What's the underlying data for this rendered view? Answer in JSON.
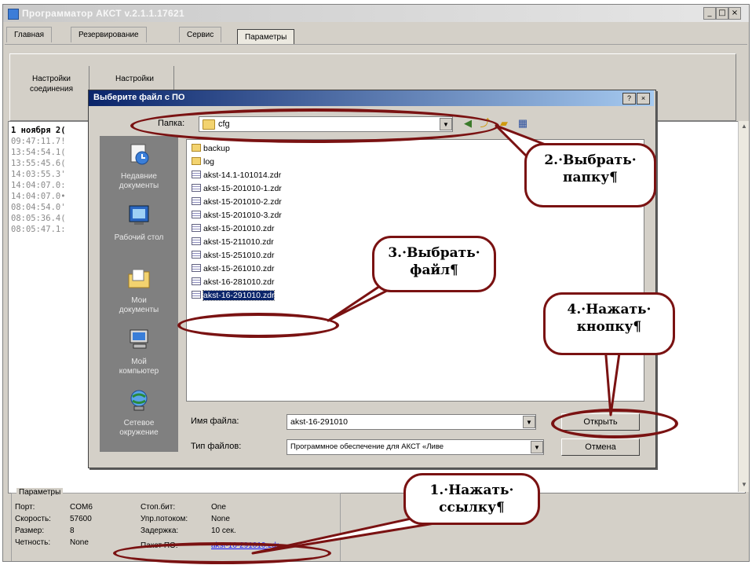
{
  "window": {
    "title": "Программатор АКСТ v.2.1.1.17621",
    "controls": [
      "_",
      "□",
      "×"
    ]
  },
  "tabs": [
    {
      "label": "Главная"
    },
    {
      "label": "Резервирование"
    },
    {
      "label": "Сервис"
    },
    {
      "label": "Параметры",
      "active": true
    }
  ],
  "toolbar": [
    {
      "line1": "Настройки",
      "line2": "соединения"
    },
    {
      "line1": "Настройки",
      "line2": ""
    }
  ],
  "log": {
    "date": "1 ноября 2(",
    "lines": [
      "09:47:11.7!",
      "13:54:54.1(",
      "13:55:45.6(",
      "14:03:55.3'",
      "14:04:07.0:",
      "14:04:07.0•",
      "08:04:54.0'",
      "08:05:36.4(",
      "08:05:47.1:"
    ]
  },
  "params": {
    "legend": "Параметры",
    "port_label": "Порт:",
    "port": "COM6",
    "speed_label": "Скорость:",
    "speed": "57600",
    "size_label": "Размер:",
    "size": "8",
    "parity_label": "Четность:",
    "parity": "None",
    "stop_bits_label": "Стоп.бит:",
    "stop_bits": "One",
    "flow_label": "Упр.потоком:",
    "flow": "None",
    "delay_label": "Задержка:",
    "delay": "10 сек.",
    "package_label": "Пакет ПО:",
    "package": "akst-16-291010.zdr"
  },
  "dialog": {
    "title": "Выберите файл с ПО",
    "help": "?",
    "close": "×",
    "folder_label": "Папка:",
    "folder": "cfg",
    "places": [
      {
        "line1": "Недавние",
        "line2": "документы",
        "icon": "recent-documents-icon"
      },
      {
        "line1": "Рабочий стол",
        "line2": "",
        "icon": "desktop-icon"
      },
      {
        "line1": "Мои",
        "line2": "документы",
        "icon": "my-documents-icon"
      },
      {
        "line1": "Мой",
        "line2": "компьютер",
        "icon": "my-computer-icon"
      },
      {
        "line1": "Сетевое",
        "line2": "окружение",
        "icon": "network-icon"
      }
    ],
    "items": [
      {
        "name": "backup",
        "type": "folder"
      },
      {
        "name": "log",
        "type": "folder"
      },
      {
        "name": "akst-14.1-101014.zdr",
        "type": "file"
      },
      {
        "name": "akst-15-201010-1.zdr",
        "type": "file"
      },
      {
        "name": "akst-15-201010-2.zdr",
        "type": "file"
      },
      {
        "name": "akst-15-201010-3.zdr",
        "type": "file"
      },
      {
        "name": "akst-15-201010.zdr",
        "type": "file"
      },
      {
        "name": "akst-15-211010.zdr",
        "type": "file"
      },
      {
        "name": "akst-15-251010.zdr",
        "type": "file"
      },
      {
        "name": "akst-15-261010.zdr",
        "type": "file"
      },
      {
        "name": "akst-16-281010.zdr",
        "type": "file"
      },
      {
        "name": "akst-16-291010.zdr",
        "type": "file",
        "selected": true
      }
    ],
    "filename_label": "Имя файла:",
    "filename": "akst-16-291010",
    "filetype_label": "Тип файлов:",
    "filetype": "Программное обеспечение для АКСТ «Ливе",
    "open_button": "Открыть",
    "cancel_button": "Отмена"
  },
  "annotations": {
    "step1": {
      "line1": "1.·Нажать·",
      "line2": "ссылку¶"
    },
    "step2": {
      "line1": "2.·Выбрать·",
      "line2": "папку¶"
    },
    "step3": {
      "line1": "3.·Выбрать·",
      "line2": "файл¶"
    },
    "step4": {
      "line1": "4.·Нажать·",
      "line2": "кнопку¶"
    }
  },
  "colors": {
    "annotation": "#7a1212",
    "dialog_title": "#0a246a",
    "selection": "#0a246a",
    "link": "#1a1aff"
  }
}
